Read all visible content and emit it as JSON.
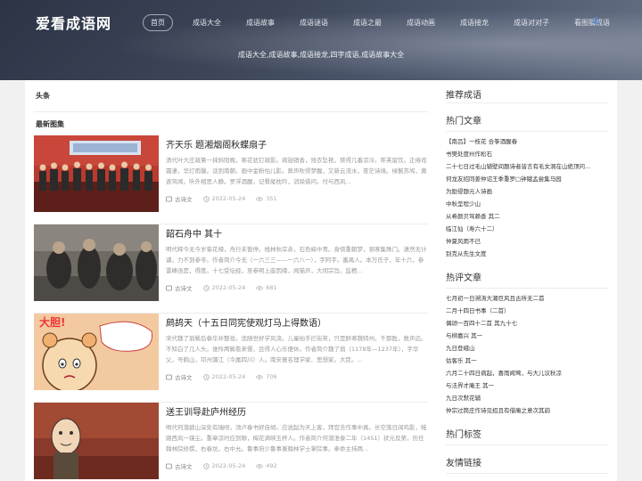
{
  "site": {
    "logo": "爱看成语网"
  },
  "nav": {
    "items": [
      "首页",
      "成语大全",
      "成语故事",
      "成语谜语",
      "成语之最",
      "成语动画",
      "成语接龙",
      "成语对对子",
      "看图猜成语"
    ],
    "description": "成语大全,成语故事,成语接龙,四字成语,成语故事大全"
  },
  "main": {
    "section_title": "头条",
    "subsection_title": "最新图集",
    "articles": [
      {
        "title": "齐天乐 题湘烟阁秋蝶扇子",
        "excerpt": "清代叶大庄疏篱一抹斜阳晚，寒花犹钉疏影。病翅销香，残衣坠艳，禁得几番凉冷。呼芙留饮。正倦戏霜凄，华灯雨馨。话到南朝，画中金粉怕儿影。葬声吹得梦醒，又新云流水，苍茫诗境。绿鬟苏鸠，黄逐驾闻，听外相思人静。罗浮酒醒，记餐尾枕吟，消除借问。付与西风...",
        "category": "古诗文",
        "date": "2022-05-24",
        "views": "351"
      },
      {
        "title": "韶石舟中 其十",
        "excerpt": "明代释今无今岁菊花辣，舟行未暂停。栈林秋岸赤，石色峡中青。身傍重朝梦，顿寒集殊门。潇然无计谴，力不到参苓。作者简介今无（一六三三——一六八一），字阿字。番禺人。本万氏子，年十六，参雷峰函是，得度。十七受坛经，至参明上座因缘，闻猫声，大彻宗旨。监栖...",
        "category": "古诗文",
        "date": "2022-05-24",
        "views": "681"
      },
      {
        "title": "鹧鸪天（十五日同宪使观灯马上得数语）",
        "excerpt": "宋代魏了翁鬓后春华并整妆。追随世好学风流。儿童拍手拦街笑，只是醉寒魏特州。千那胜，数声远。不知白了几人头。谁怜两鬓看来儒，且得人心乐便休。作者简介魏了翁（1178年—1237年），字华父，号鹤山，邛州蒲江（今属四川）人。南宋著名理学家、思想家。大臣。...",
        "category": "古诗文",
        "date": "2022-05-24",
        "views": "706"
      },
      {
        "title": "送王训导赴庐州经历",
        "excerpt": "明代何潜碧山深处有瑞呀，须卢春书好自胡。应说起为天上客，拜官去作事中真。长空落日阔鸡影，畦路西风一镜尘。重章凉时应到聊，梅花满映玉杯人。作者简介何潜淮泰二年（1451）状元及第，历任翰林院修撰，右春坊，右中允。鲁事府少鲁事兼翰林学士掌院事。奉命主持两...",
        "category": "古诗文",
        "date": "2022-05-24",
        "views": "492"
      }
    ]
  },
  "sidebar": {
    "recommend_title": "推荐成语",
    "hot_articles_title": "热门文章",
    "hot_articles": [
      "【南吕】一枝花 合筝酒醒春",
      "书樊处度州作松石",
      "二十七日过毛山辅壁间题诗者皆言有毛女洞在山绝顶问...",
      "何龙友招同姜仲诏王季重罗□钟娥孟尝集马园",
      "为励侵题元人诗画",
      "中秋呈程少山",
      "从希颜贝驾赖香 其二",
      "临江仙（寿六十二）",
      "仲夏风雨不已",
      "别克从先生文度"
    ],
    "comments_title": "热评文章",
    "comments": [
      "七月初一日溯涛大潮巨风且古所无二首",
      "二月十四日书事（二首）",
      "偶颂一百四十二首 其九十七",
      "与柳嘉兴 其一",
      "九日登峨山",
      "估客乐 其一",
      "六月二十四日病起，喜雨闻莺，与大儿议秋凉",
      "与法界才庵王 其一",
      "九日次默花辅",
      "仲宗过筒庄作诗见招且有借庵之意次其韵"
    ],
    "tags_title": "热门标签",
    "links_title": "友情链接"
  },
  "colors": {
    "header_dark": "#2c3446",
    "accent": "#4a6fa5"
  }
}
